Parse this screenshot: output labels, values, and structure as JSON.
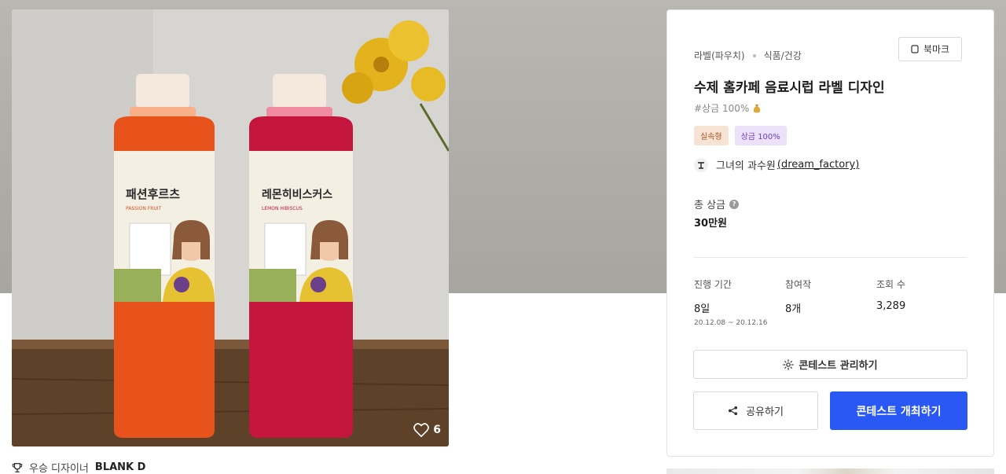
{
  "gallery": {
    "bottle_left": {
      "name": "패션후르츠",
      "sub": "PASSION FRUIT"
    },
    "bottle_right": {
      "name": "레몬히비스커스",
      "sub": "LEMON HIBISCUS"
    },
    "like_count": "6",
    "winner_label": "우승 디자이너",
    "winner_name": "BLANK D"
  },
  "contest": {
    "category": "라벨(파우치)",
    "subcategory": "식품/건강",
    "bookmark_label": "북마크",
    "title": "수제 홈카페 음료시럽 라벨 디자인",
    "subtag": "#상금 100%",
    "badges": [
      "실속형",
      "상금 100%"
    ],
    "host_name": "그녀의 과수원",
    "host_handle": "(dream_factory)",
    "prize_label": "총 상금",
    "prize_value": "30만원",
    "stats": {
      "period_label": "진행 기간",
      "period_value": "8일",
      "period_dates": "20.12.08 ~ 20.12.16",
      "entries_label": "참여작",
      "entries_value": "8개",
      "views_label": "조회 수",
      "views_value": "3,289"
    },
    "manage_label": "콘테스트 관리하기",
    "share_label": "공유하기",
    "host_button_label": "콘테스트 개최하기"
  },
  "colors": {
    "primary": "#2a58f4",
    "badge_orange_bg": "#f7e3d3",
    "badge_purple_bg": "#ece1f9",
    "bottle_orange": "#e8531c",
    "bottle_red": "#c4163d"
  }
}
